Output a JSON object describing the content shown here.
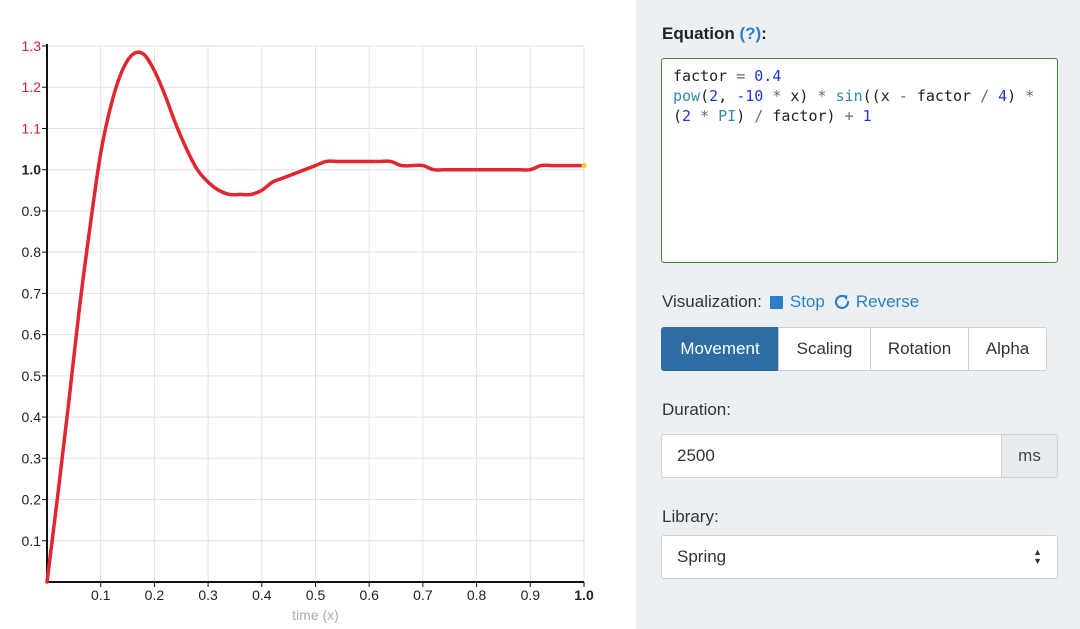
{
  "chart_data": {
    "type": "line",
    "title": "",
    "xlabel": "time (x)",
    "ylabel": "",
    "xlim": [
      0,
      1.0
    ],
    "ylim": [
      0,
      1.3
    ],
    "x_ticks": [
      "0.1",
      "0.2",
      "0.3",
      "0.4",
      "0.5",
      "0.6",
      "0.7",
      "0.8",
      "0.9",
      "1.0"
    ],
    "y_ticks": [
      "0.1",
      "0.2",
      "0.3",
      "0.4",
      "0.5",
      "0.6",
      "0.7",
      "0.8",
      "0.9",
      "1.0",
      "1.1",
      "1.2",
      "1.3"
    ],
    "grid": true,
    "highlight_color": "#e02020",
    "series": [
      {
        "color": "#e0262f",
        "x": [
          0,
          0.02,
          0.04,
          0.06,
          0.08,
          0.1,
          0.12,
          0.14,
          0.16,
          0.18,
          0.2,
          0.22,
          0.24,
          0.26,
          0.28,
          0.3,
          0.32,
          0.34,
          0.36,
          0.38,
          0.4,
          0.42,
          0.44,
          0.46,
          0.48,
          0.5,
          0.52,
          0.54,
          0.56,
          0.58,
          0.6,
          0.62,
          0.64,
          0.66,
          0.68,
          0.7,
          0.72,
          0.74,
          0.76,
          0.78,
          0.8,
          0.82,
          0.84,
          0.86,
          0.88,
          0.9,
          0.92,
          0.94,
          0.96,
          0.98,
          1.0
        ],
        "y": [
          0,
          0.21,
          0.43,
          0.66,
          0.86,
          1.04,
          1.16,
          1.24,
          1.28,
          1.28,
          1.24,
          1.18,
          1.11,
          1.05,
          1.0,
          0.97,
          0.95,
          0.94,
          0.94,
          0.94,
          0.95,
          0.97,
          0.98,
          0.99,
          1.0,
          1.01,
          1.02,
          1.02,
          1.02,
          1.02,
          1.02,
          1.02,
          1.02,
          1.01,
          1.01,
          1.01,
          1.0,
          1.0,
          1.0,
          1.0,
          1.0,
          1.0,
          1.0,
          1.0,
          1.0,
          1.0,
          1.01,
          1.01,
          1.01,
          1.01,
          1.01
        ]
      }
    ]
  },
  "panel": {
    "equation_label": "Equation",
    "help_link": "(?)",
    "help_suffix": ":",
    "equation_lines": [
      [
        {
          "t": "factor ",
          "c": ""
        },
        {
          "t": "=",
          "c": "op"
        },
        {
          "t": " ",
          "c": ""
        },
        {
          "t": "0.4",
          "c": "num"
        }
      ],
      [
        {
          "t": "pow",
          "c": "fn"
        },
        {
          "t": "(",
          "c": ""
        },
        {
          "t": "2",
          "c": "num"
        },
        {
          "t": ", ",
          "c": ""
        },
        {
          "t": "-10",
          "c": "num"
        },
        {
          "t": " ",
          "c": ""
        },
        {
          "t": "*",
          "c": "op"
        },
        {
          "t": " x) ",
          "c": ""
        },
        {
          "t": "*",
          "c": "op"
        },
        {
          "t": " ",
          "c": ""
        },
        {
          "t": "sin",
          "c": "fn"
        },
        {
          "t": "((x ",
          "c": ""
        },
        {
          "t": "-",
          "c": "op"
        },
        {
          "t": " factor ",
          "c": ""
        },
        {
          "t": "/",
          "c": "op"
        },
        {
          "t": " ",
          "c": ""
        },
        {
          "t": "4",
          "c": "num"
        },
        {
          "t": ") ",
          "c": ""
        },
        {
          "t": "*",
          "c": "op"
        }
      ],
      [
        {
          "t": "(",
          "c": ""
        },
        {
          "t": "2",
          "c": "num"
        },
        {
          "t": " ",
          "c": ""
        },
        {
          "t": "*",
          "c": "op"
        },
        {
          "t": " ",
          "c": ""
        },
        {
          "t": "PI",
          "c": "const"
        },
        {
          "t": ") ",
          "c": ""
        },
        {
          "t": "/",
          "c": "op"
        },
        {
          "t": " factor) ",
          "c": ""
        },
        {
          "t": "+",
          "c": "op"
        },
        {
          "t": " ",
          "c": ""
        },
        {
          "t": "1",
          "c": "num"
        }
      ]
    ],
    "visualization_label": "Visualization:",
    "stop_label": "Stop",
    "reverse_label": "Reverse",
    "tabs": [
      {
        "label": "Movement",
        "active": true
      },
      {
        "label": "Scaling",
        "active": false
      },
      {
        "label": "Rotation",
        "active": false
      },
      {
        "label": "Alpha",
        "active": false
      }
    ],
    "duration_label": "Duration:",
    "duration_value": "2500",
    "duration_unit": "ms",
    "library_label": "Library:",
    "library_value": "Spring"
  }
}
